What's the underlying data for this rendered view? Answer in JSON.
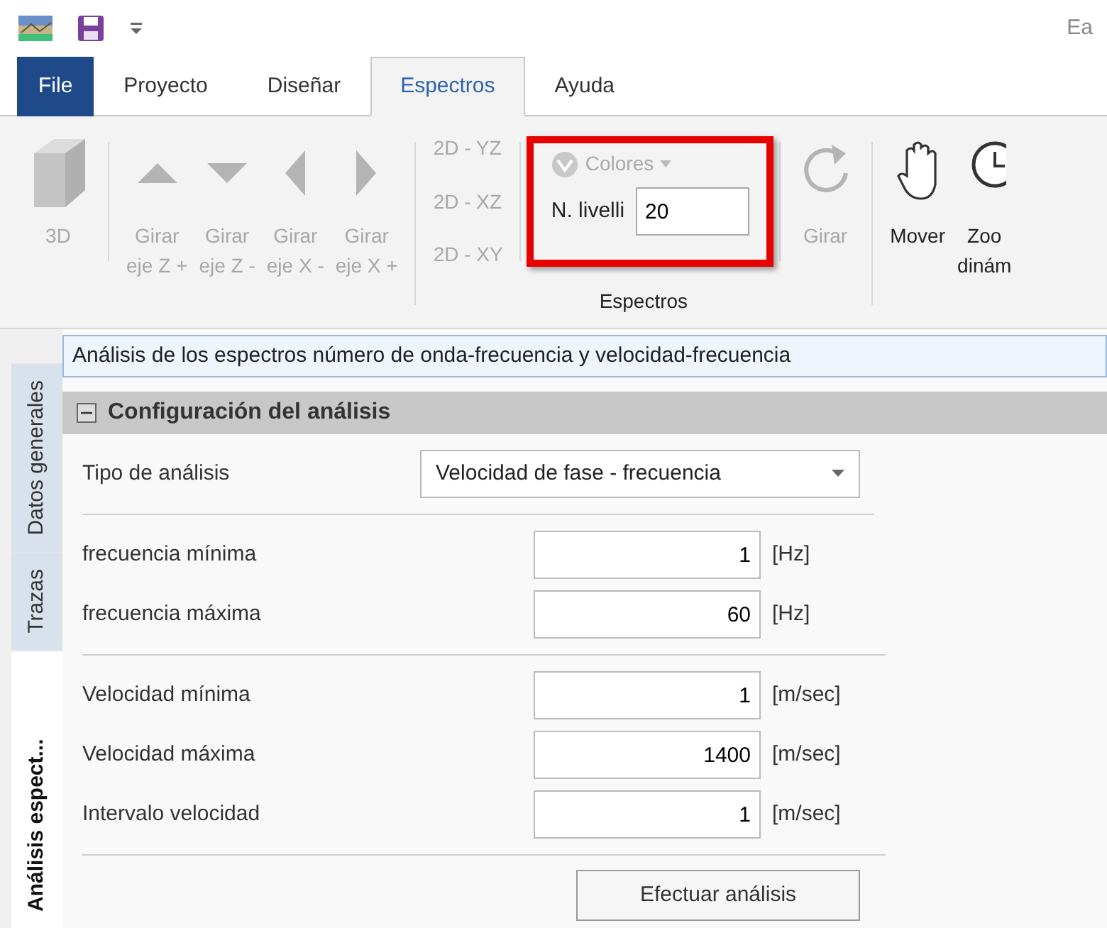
{
  "title_bar": {
    "title": "Ea"
  },
  "menu_tabs": [
    {
      "label": "File",
      "kind": "file",
      "selected": false
    },
    {
      "label": "Proyecto",
      "kind": "tab",
      "selected": false
    },
    {
      "label": "Diseñar",
      "kind": "tab",
      "selected": false
    },
    {
      "label": "Espectros",
      "kind": "tab",
      "selected": true
    },
    {
      "label": "Ayuda",
      "kind": "tab",
      "selected": false
    }
  ],
  "ribbon": {
    "sections": [
      {
        "groups": [
          {
            "items": [
              {
                "kind": "button",
                "lines": [
                  "3D"
                ],
                "disabled": true
              }
            ]
          },
          {
            "items": [
              {
                "kind": "button",
                "lines": [
                  "Girar",
                  "eje Z +"
                ],
                "disabled": true
              },
              {
                "kind": "button",
                "lines": [
                  "Girar",
                  "eje Z -"
                ],
                "disabled": true
              },
              {
                "kind": "button",
                "lines": [
                  "Girar",
                  "eje X -"
                ],
                "disabled": true
              },
              {
                "kind": "button",
                "lines": [
                  "Girar",
                  "eje X +"
                ],
                "disabled": true
              }
            ]
          }
        ]
      },
      {
        "label": "Espectros",
        "groups": [
          {
            "items": [
              {
                "kind": "stack",
                "entries": [
                  "2D - YZ",
                  "2D - XZ",
                  "2D - XY"
                ],
                "disabled": true
              }
            ]
          },
          {
            "highlighted": true,
            "items": [
              {
                "kind": "levels",
                "dropdown": "Colores",
                "dropdown_disabled": true,
                "label": "N. livelli",
                "value": "20"
              }
            ]
          },
          {
            "items": [
              {
                "kind": "button",
                "lines": [
                  "Girar"
                ],
                "disabled": true
              }
            ]
          }
        ]
      },
      {
        "groups": [
          {
            "items": [
              {
                "kind": "button",
                "lines": [
                  "Mover"
                ],
                "disabled": false
              },
              {
                "kind": "button",
                "lines": [
                  "Zoo",
                  "dinám"
                ],
                "disabled": false
              }
            ]
          }
        ]
      }
    ]
  },
  "side_tabs": [
    {
      "label": "Datos generales",
      "selected": false
    },
    {
      "label": "Trazas",
      "selected": false
    },
    {
      "label": "Análisis espect...",
      "selected": true
    }
  ],
  "form": {
    "description": "Análisis de los espectros número de onda-frecuencia y velocidad-frecuencia",
    "section": {
      "title": "Configuración del análisis",
      "expanded": true
    },
    "groups": [
      [
        {
          "kind": "select",
          "label": "Tipo de análisis",
          "value": "Velocidad de fase - frecuencia"
        }
      ],
      [
        {
          "kind": "number",
          "label": "frecuencia mínima",
          "value": "1",
          "unit": "[Hz]"
        },
        {
          "kind": "number",
          "label": "frecuencia máxima",
          "value": "60",
          "unit": "[Hz]"
        }
      ],
      [
        {
          "kind": "number",
          "label": "Velocidad mínima",
          "value": "1",
          "unit": "[m/sec]"
        },
        {
          "kind": "number",
          "label": "Velocidad máxima",
          "value": "1400",
          "unit": "[m/sec]"
        },
        {
          "kind": "number",
          "label": "Intervalo velocidad",
          "value": "1",
          "unit": "[m/sec]"
        }
      ]
    ],
    "button": "Efectuar análisis"
  }
}
